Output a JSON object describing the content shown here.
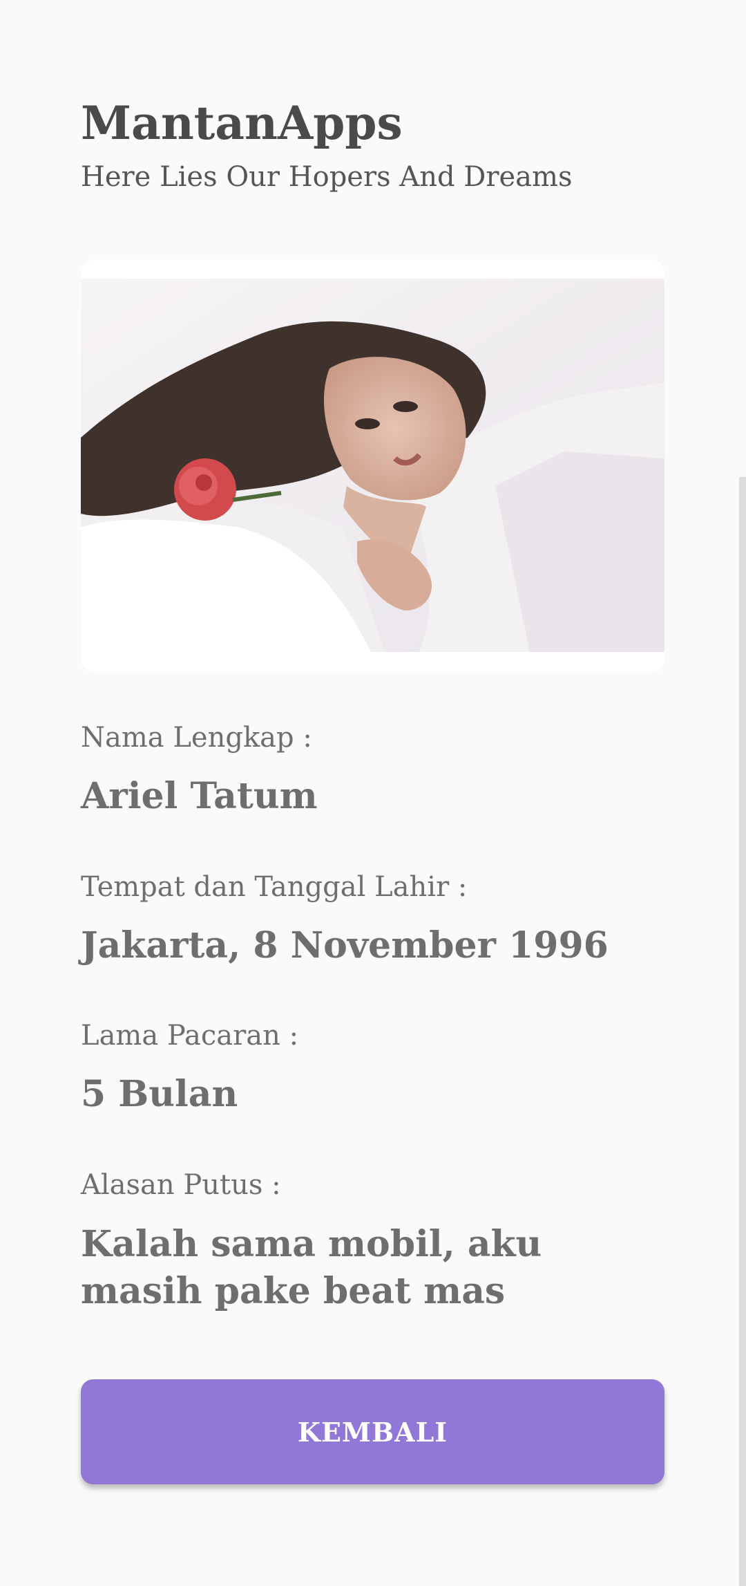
{
  "header": {
    "title": "MantanApps",
    "subtitle": "Here Lies Our Hopers And Dreams"
  },
  "profile": {
    "photo_alt": "photo",
    "fields": [
      {
        "label": "Nama Lengkap :",
        "value": "Ariel Tatum"
      },
      {
        "label": "Tempat dan Tanggal Lahir :",
        "value": "Jakarta, 8 November 1996"
      },
      {
        "label": "Lama Pacaran :",
        "value": "5 Bulan"
      },
      {
        "label": "Alasan Putus :",
        "value": "Kalah sama mobil, aku masih pake beat mas"
      }
    ]
  },
  "actions": {
    "back_label": "KEMBALI"
  },
  "colors": {
    "background": "#fafafa",
    "accent": "#9177d6",
    "title_text": "#4a4a4a",
    "body_text": "#6e6e6e"
  }
}
